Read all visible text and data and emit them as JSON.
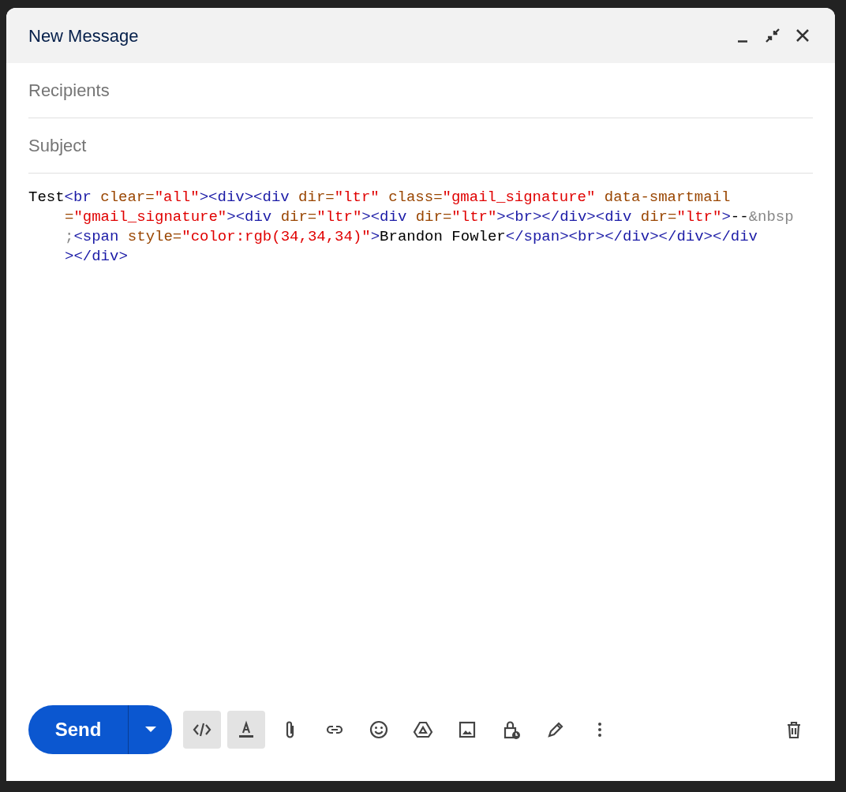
{
  "window": {
    "title": "New Message",
    "controls": [
      {
        "kind": "minimize"
      },
      {
        "kind": "exit-fullscreen"
      },
      {
        "kind": "close"
      }
    ]
  },
  "recipients": {
    "placeholder": "Recipients"
  },
  "subject": {
    "placeholder": "Subject"
  },
  "body": {
    "lines": [
      [
        {
          "kind": "text",
          "text": "Test"
        },
        {
          "kind": "tag",
          "text": "<br"
        },
        {
          "kind": "attr",
          "text": " clear="
        },
        {
          "kind": "value",
          "text": "\"all\""
        },
        {
          "kind": "tag",
          "text": "><div><div"
        },
        {
          "kind": "attr",
          "text": " dir="
        },
        {
          "kind": "value",
          "text": "\"ltr\""
        },
        {
          "kind": "attr",
          "text": " class="
        },
        {
          "kind": "value",
          "text": "\"gmail_signature\""
        },
        {
          "kind": "attr",
          "text": " data-smartmail"
        }
      ],
      [
        {
          "kind": "attr",
          "text": "="
        },
        {
          "kind": "value",
          "text": "\"gmail_signature\""
        },
        {
          "kind": "tag",
          "text": "><div"
        },
        {
          "kind": "attr",
          "text": " dir="
        },
        {
          "kind": "value",
          "text": "\"ltr\""
        },
        {
          "kind": "tag",
          "text": "><div"
        },
        {
          "kind": "attr",
          "text": " dir="
        },
        {
          "kind": "value",
          "text": "\"ltr\""
        },
        {
          "kind": "tag",
          "text": "><br></div><div"
        },
        {
          "kind": "attr",
          "text": " dir="
        },
        {
          "kind": "value",
          "text": "\"ltr\""
        },
        {
          "kind": "tag",
          "text": ">"
        },
        {
          "kind": "text",
          "text": "--"
        },
        {
          "kind": "entity",
          "text": "&nbsp"
        }
      ],
      [
        {
          "kind": "entity",
          "text": ";"
        },
        {
          "kind": "tag",
          "text": "<span"
        },
        {
          "kind": "attr",
          "text": " style="
        },
        {
          "kind": "value",
          "text": "\"color:rgb(34,34,34)\""
        },
        {
          "kind": "tag",
          "text": ">"
        },
        {
          "kind": "text",
          "text": "Brandon Fowler"
        },
        {
          "kind": "tag",
          "text": "</span><br></div></div></div"
        }
      ],
      [
        {
          "kind": "tag",
          "text": "></div>"
        }
      ]
    ]
  },
  "send_button": {
    "label": "Send"
  },
  "toolbar": [
    {
      "kind": "code",
      "selected": true
    },
    {
      "kind": "format",
      "selected": true
    },
    {
      "kind": "attach",
      "selected": false
    },
    {
      "kind": "link",
      "selected": false
    },
    {
      "kind": "emoji",
      "selected": false
    },
    {
      "kind": "drive",
      "selected": false
    },
    {
      "kind": "image",
      "selected": false
    },
    {
      "kind": "lock",
      "selected": false
    },
    {
      "kind": "signature",
      "selected": false
    },
    {
      "kind": "more",
      "selected": false
    }
  ],
  "discard": {
    "kind": "trash"
  }
}
